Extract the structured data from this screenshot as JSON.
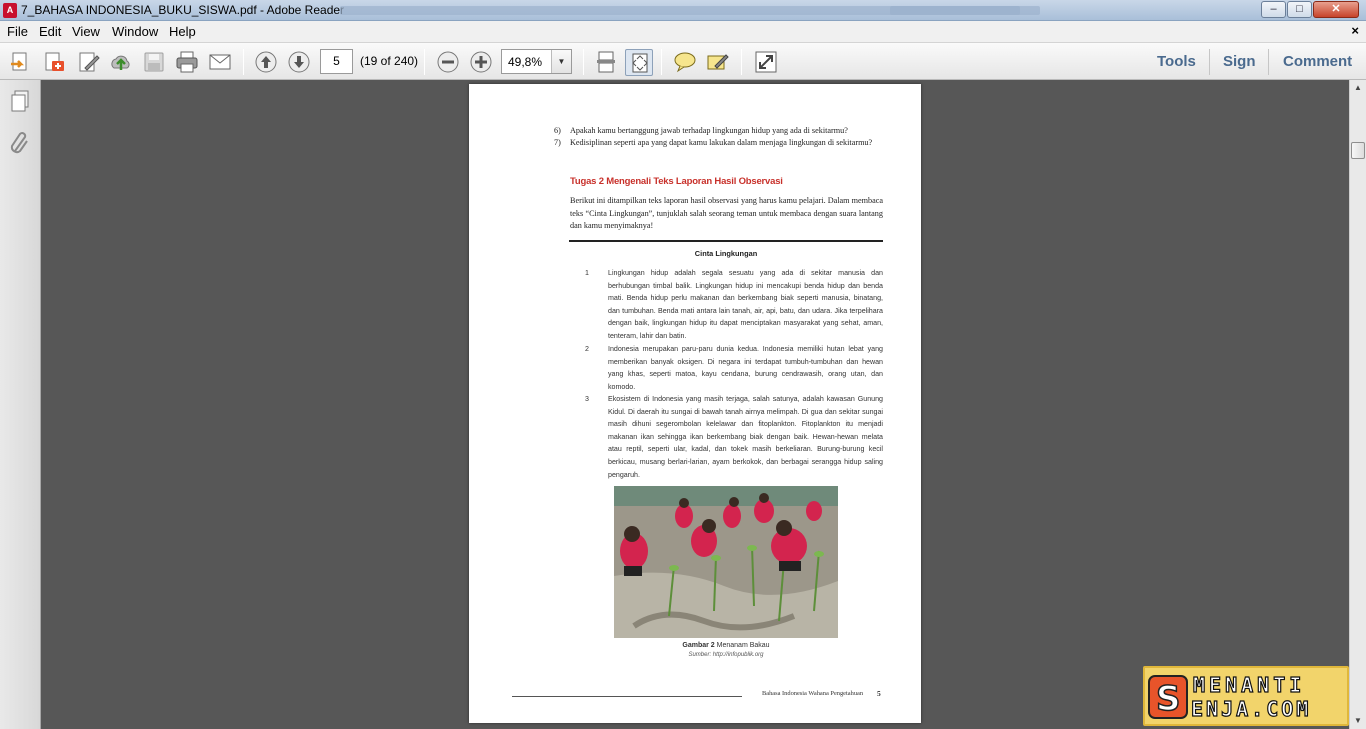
{
  "window": {
    "title": "7_BAHASA INDONESIA_BUKU_SISWA.pdf - Adobe Reader",
    "app_icon": "acrobat-icon",
    "controls": {
      "minimize": "–",
      "maximize": "□",
      "close": "✕"
    }
  },
  "menu": {
    "items": [
      "File",
      "Edit",
      "View",
      "Window",
      "Help"
    ],
    "close_doc": "×"
  },
  "toolbar": {
    "icons": [
      "open-icon",
      "create-pdf-icon",
      "edit-icon",
      "upload-cloud-icon",
      "save-icon",
      "print-icon",
      "email-icon",
      "previous-page-icon",
      "next-page-icon",
      "zoom-out-icon",
      "zoom-in-icon",
      "scroll-mode-icon",
      "fit-page-icon",
      "comment-icon",
      "highlight-icon",
      "full-screen-icon"
    ],
    "page_number": "5",
    "page_count": "(19 of 240)",
    "zoom": "49,8%",
    "links": {
      "tools": "Tools",
      "sign": "Sign",
      "comment": "Comment"
    }
  },
  "navpane": {
    "icons": [
      "pages-icon",
      "attachments-icon"
    ]
  },
  "document": {
    "questions": [
      {
        "num": "6)",
        "text": "Apakah kamu bertanggung jawab terhadap lingkungan hidup yang ada di sekitarmu?"
      },
      {
        "num": "7)",
        "text": "Kedisiplinan seperti apa yang dapat kamu lakukan dalam menjaga lingkungan di sekitarmu?"
      }
    ],
    "task_heading": "Tugas 2 Mengenali Teks Laporan Hasil Observasi",
    "intro": "Berikut ini ditampilkan teks laporan hasil observasi yang harus kamu pelajari. Dalam membaca teks “Cinta Lingkungan”, tunjuklah salah seorang teman untuk membaca dengan suara lantang dan kamu menyimaknya!",
    "text_title": "Cinta Lingkungan",
    "paragraphs": [
      {
        "num": "1",
        "text": "Lingkungan hidup adalah segala sesuatu yang ada di sekitar manusia dan berhubungan timbal balik. Lingkungan hidup ini mencakupi benda hidup dan benda mati. Benda hidup perlu makanan dan berkembang biak seperti manusia, binatang, dan tumbuhan. Benda mati antara lain tanah, air, api, batu, dan udara. Jika terpelihara dengan baik, lingkungan hidup itu dapat menciptakan masyarakat yang sehat, aman, tenteram, lahir dan batin."
      },
      {
        "num": "2",
        "text": "Indonesia merupakan paru-paru dunia kedua. Indonesia memiliki hutan lebat yang memberikan banyak oksigen. Di negara ini terdapat tumbuh-tumbuhan dan hewan yang khas, seperti matoa, kayu cendana, burung cendrawasih, orang utan, dan komodo."
      },
      {
        "num": "3",
        "text": "Ekosistem di Indonesia yang masih terjaga, salah satunya, adalah kawasan Gunung Kidul. Di daerah itu sungai di bawah tanah airnya melimpah. Di gua dan sekitar sungai masih dihuni segerombolan kelelawar dan fitoplankton. Fitoplankton itu menjadi makanan ikan sehingga ikan berkembang biak dengan baik. Hewan-hewan melata atau reptil, seperti ular, kadal, dan tokek masih berkeliaran. Burung-burung kecil berkicau, musang berlari-larian, ayam berkokok, dan berbagai serangga hidup saling pengaruh."
      }
    ],
    "caption_label": "Gambar 2",
    "caption_text": " Menanam Bakau",
    "source": "Sumber: http://infopublik.org",
    "footer_text": "Bahasa Indonesia Wahana Pengetahuan",
    "footer_page": "5"
  },
  "watermark": {
    "text_top": "MENANTI",
    "text_bottom": "ENJA.COM",
    "initial": "S"
  },
  "colors": {
    "heading_red": "#c8312b",
    "link_blue": "#4a6a8e",
    "watermark_bg": "#f2d46b"
  }
}
